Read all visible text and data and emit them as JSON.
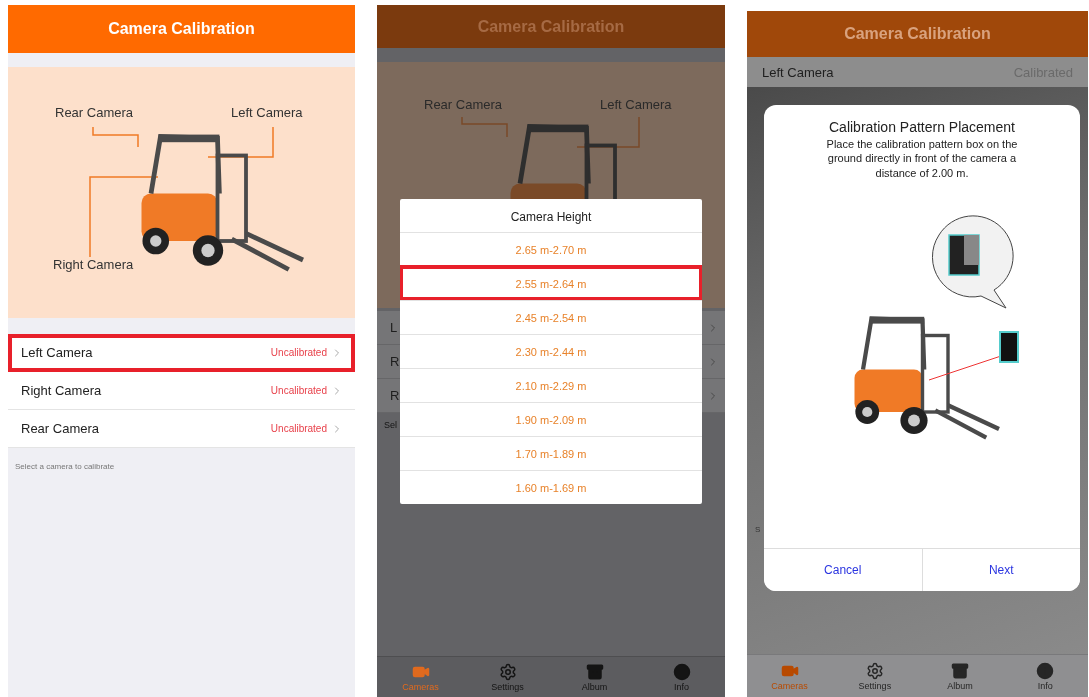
{
  "screens": [
    {
      "kind": "camera-list",
      "title": "Camera Calibration",
      "diagram_labels": [
        "Rear Camera",
        "Left Camera",
        "Right Camera"
      ],
      "cameras": [
        {
          "name": "Left Camera",
          "status": "Uncalibrated",
          "selected": true
        },
        {
          "name": "Right Camera",
          "status": "Uncalibrated",
          "selected": false
        },
        {
          "name": "Rear Camera",
          "status": "Uncalibrated",
          "selected": false
        }
      ],
      "hint": "Select a camera to calibrate"
    },
    {
      "kind": "height-picker",
      "title": "Camera Calibration",
      "diagram_labels": [
        "Rear Camera",
        "Left Camera"
      ],
      "row_fragments": [
        "L",
        "R",
        "R"
      ],
      "hint_fragment": "Sel",
      "dialog": {
        "title": "Camera Height",
        "options": [
          {
            "label": "2.65 m-2.70 m",
            "selected": false
          },
          {
            "label": "2.55 m-2.64 m",
            "selected": true
          },
          {
            "label": "2.45 m-2.54 m",
            "selected": false
          },
          {
            "label": "2.30 m-2.44 m",
            "selected": false
          },
          {
            "label": "2.10 m-2.29 m",
            "selected": false
          },
          {
            "label": "1.90 m-2.09 m",
            "selected": false
          },
          {
            "label": "1.70 m-1.89 m",
            "selected": false
          },
          {
            "label": "1.60 m-1.69 m",
            "selected": false
          }
        ]
      },
      "tabs": [
        {
          "label": "Cameras",
          "selected": true
        },
        {
          "label": "Settings",
          "selected": false
        },
        {
          "label": "Album",
          "selected": false
        },
        {
          "label": "Info",
          "selected": false
        }
      ]
    },
    {
      "kind": "placement",
      "title": "Camera Calibration",
      "camera": {
        "name": "Left Camera",
        "status": "Calibrated"
      },
      "hint_fragment": "S",
      "dialog": {
        "title": "Calibration Pattern Placement",
        "message": "Place the calibration pattern box on the ground directly in front of the camera a distance of 2.00 m.",
        "buttons": [
          "Cancel",
          "Next"
        ]
      },
      "tabs": [
        {
          "label": "Cameras",
          "selected": true
        },
        {
          "label": "Settings",
          "selected": false
        },
        {
          "label": "Album",
          "selected": false
        },
        {
          "label": "Info",
          "selected": false
        }
      ]
    }
  ]
}
